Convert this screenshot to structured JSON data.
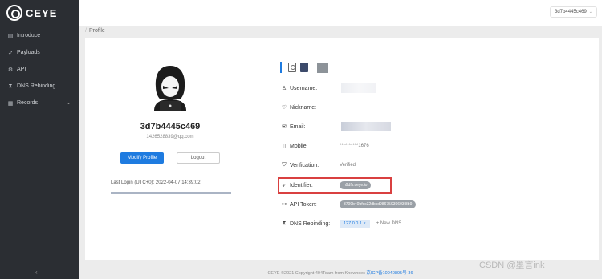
{
  "app": {
    "name": "CEYE"
  },
  "sidebar": {
    "items": [
      {
        "label": "Introduce",
        "icon": "document-icon"
      },
      {
        "label": "Payloads",
        "icon": "rocket-icon"
      },
      {
        "label": "API",
        "icon": "api-icon"
      },
      {
        "label": "DNS Rebinding",
        "icon": "hourglass-icon"
      },
      {
        "label": "Records",
        "icon": "records-icon"
      }
    ]
  },
  "header": {
    "user": "3d7b4445c469"
  },
  "breadcrumb": {
    "label": "Profile"
  },
  "profile": {
    "username": "3d7b4445c469",
    "email": "1426528839@qq.com",
    "modify_label": "Modify Profile",
    "logout_label": "Logout",
    "last_login": "Last Login (UTC+0): 2022-04-07 14:39:02"
  },
  "details": {
    "username_label": "Username:",
    "nickname_label": "Nickname:",
    "email_label": "Email:",
    "mobile_label": "Mobile:",
    "mobile_value": "**********1676",
    "verification_label": "Verification:",
    "verification_value": "Verified",
    "identifier_label": "Identifier:",
    "identifier_value": "h9dfs.ceye.io",
    "api_token_label": "API Token:",
    "api_token_value": "3709b40bfcc32dbcd98675939603f8b9",
    "dns_label": "DNS Rebinding:",
    "dns_tag": "127.0.0.1",
    "dns_tag_close": "×",
    "new_dns": "+ New DNS"
  },
  "footer": {
    "text": "CEYE ©2021 Copyright 404Team from Knownsec",
    "icp": "京ICP备10040895号-36"
  },
  "watermark": "CSDN @墨言ink",
  "colors": {
    "accent": "#1e7be0",
    "sidebar_bg": "#2b2e33",
    "highlight": "#d94040"
  }
}
